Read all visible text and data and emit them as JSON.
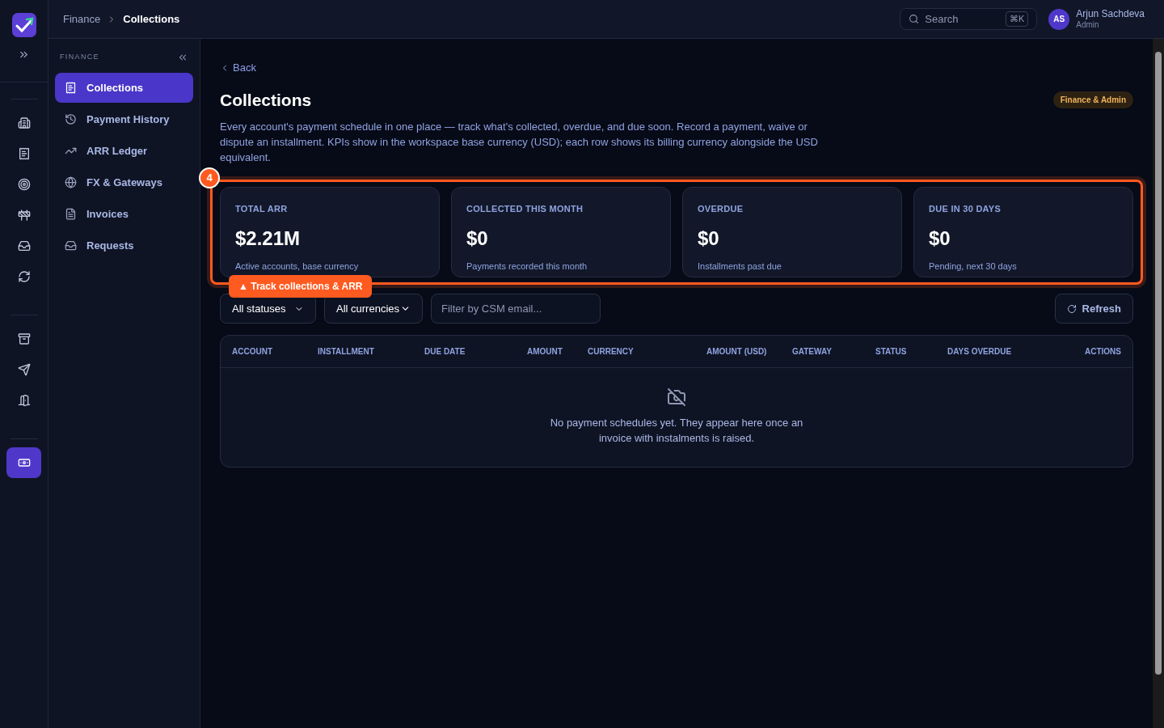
{
  "rail": {
    "groups": [
      [
        {
          "kind": "building",
          "selected": false
        },
        {
          "kind": "receipt",
          "selected": false
        },
        {
          "kind": "target",
          "selected": false
        },
        {
          "kind": "barrier",
          "selected": false
        },
        {
          "kind": "inbox",
          "selected": false
        },
        {
          "kind": "refresh",
          "selected": false
        }
      ],
      [
        {
          "kind": "archive",
          "selected": false
        },
        {
          "kind": "send",
          "selected": false
        },
        {
          "kind": "exit",
          "selected": false
        }
      ],
      [
        {
          "kind": "cash",
          "selected": true
        }
      ]
    ]
  },
  "breadcrumb": [
    "Finance",
    "Collections"
  ],
  "search": {
    "placeholder": "Search",
    "shortcut": "⌘K"
  },
  "user": {
    "initials": "AS",
    "name": "Arjun Sachdeva",
    "role": "Admin"
  },
  "sidebar": {
    "heading": "FINANCE",
    "items": [
      {
        "label": "Collections",
        "selected": true
      },
      {
        "label": "Payment History",
        "selected": false
      },
      {
        "label": "ARR Ledger",
        "selected": false
      },
      {
        "label": "FX & Gateways",
        "selected": false
      },
      {
        "label": "Invoices",
        "selected": false
      },
      {
        "label": "Requests",
        "selected": false
      }
    ]
  },
  "back": "Back",
  "title": "Collections",
  "badge": "Finance & Admin",
  "description": "Every account's payment schedule in one place — track what's collected, overdue, and due soon. Record a payment, waive or dispute an installment. KPIs show in the workspace base currency (USD); each row shows its billing currency alongside the USD equivalent.",
  "kpis": [
    {
      "label": "TOTAL ARR",
      "value": "$2.21M",
      "note": "Active accounts, base currency"
    },
    {
      "label": "COLLECTED THIS MONTH",
      "value": "$0",
      "note": "Payments recorded this month"
    },
    {
      "label": "OVERDUE",
      "value": "$0",
      "note": "Installments past due"
    },
    {
      "label": "DUE IN 30 DAYS",
      "value": "$0",
      "note": "Pending, next 30 days"
    }
  ],
  "tour": {
    "step": "4",
    "tooltip": "▲ Track collections & ARR"
  },
  "filters": {
    "status": "All statuses",
    "currency": "All currencies",
    "csm_placeholder": "Filter by CSM email..."
  },
  "refresh": "Refresh",
  "table": {
    "columns": [
      "ACCOUNT",
      "INSTALLMENT",
      "DUE DATE",
      "AMOUNT",
      "CURRENCY",
      "AMOUNT (USD)",
      "GATEWAY",
      "STATUS",
      "DAYS OVERDUE",
      "ACTIONS"
    ],
    "empty": "No payment schedules yet. They appear here once an invoice with instalments is raised."
  }
}
